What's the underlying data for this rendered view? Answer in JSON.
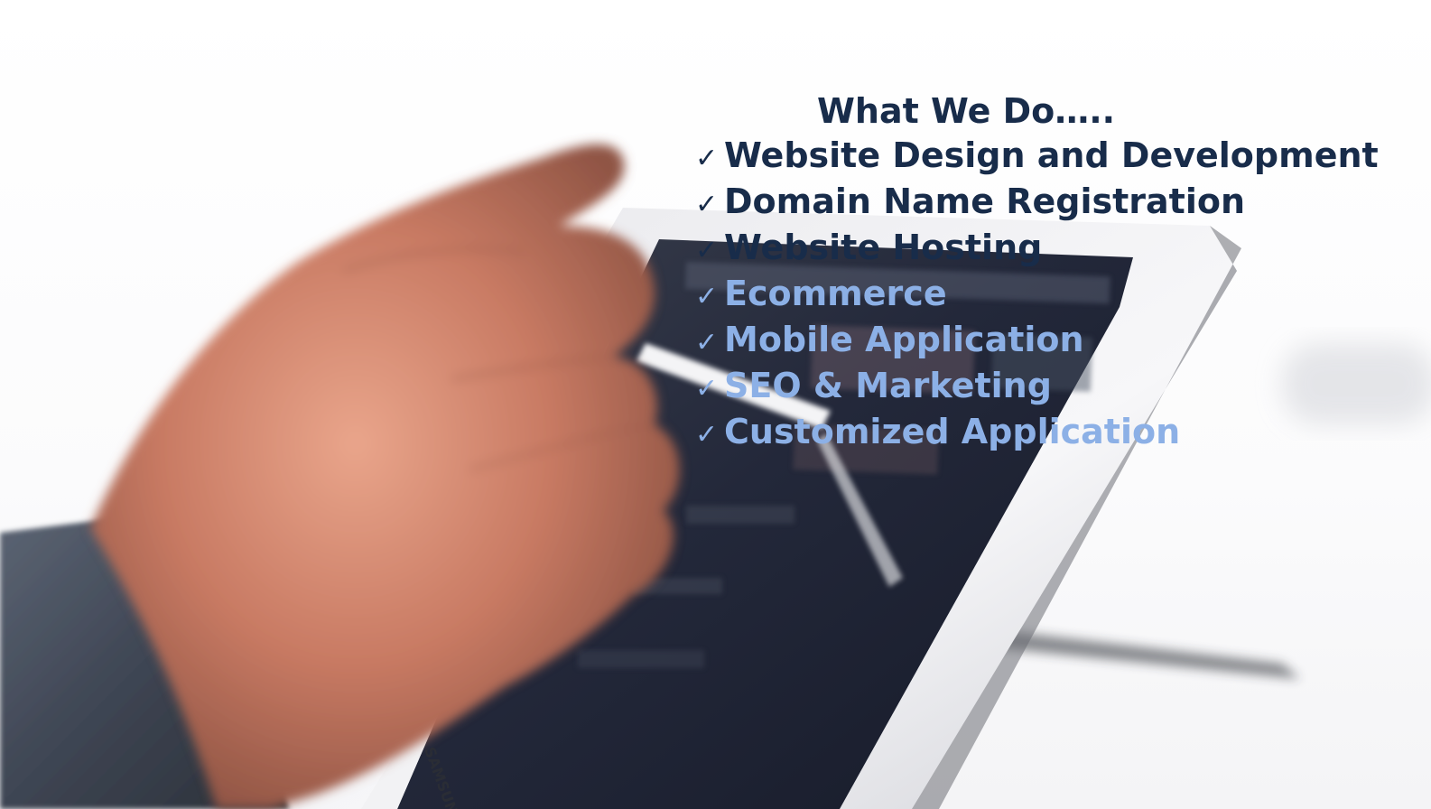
{
  "heading": "What We Do…..",
  "check_symbol": "✓",
  "colors": {
    "dark_text": "#182c4a",
    "light_text": "#8cb0e6"
  },
  "services": [
    {
      "label": "Website Design and Development",
      "tone": "dark"
    },
    {
      "label": "Domain Name Registration",
      "tone": "dark"
    },
    {
      "label": "Website Hosting",
      "tone": "dark"
    },
    {
      "label": "Ecommerce",
      "tone": "light"
    },
    {
      "label": "Mobile Application",
      "tone": "light"
    },
    {
      "label": "SEO & Marketing",
      "tone": "light"
    },
    {
      "label": "Customized Application",
      "tone": "light"
    }
  ],
  "background_photo": {
    "subject": "hand holding stylus on tablet",
    "device_brand_text": "SAMSUNG"
  }
}
